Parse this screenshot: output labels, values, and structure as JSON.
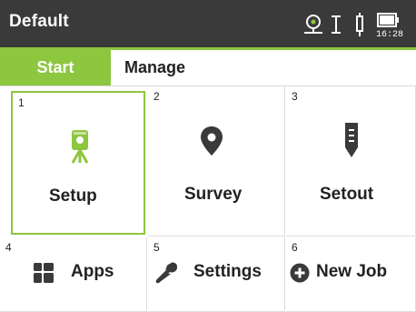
{
  "header": {
    "title": "Default",
    "time": "16:28",
    "status_icons": [
      "target-icon",
      "cursor-i-icon",
      "pole-icon",
      "battery-icon"
    ]
  },
  "colors": {
    "accent": "#8dc63f",
    "titlebar_bg": "#3a3a3a",
    "text": "#222222"
  },
  "tabs": [
    {
      "label": "Start",
      "active": true
    },
    {
      "label": "Manage",
      "active": false
    }
  ],
  "tiles": [
    {
      "number": "1",
      "label": "Setup",
      "icon": "tripod-icon",
      "selected": true
    },
    {
      "number": "2",
      "label": "Survey",
      "icon": "map-pin-icon",
      "selected": false
    },
    {
      "number": "3",
      "label": "Setout",
      "icon": "stake-icon",
      "selected": false
    },
    {
      "number": "4",
      "label": "Apps",
      "icon": "apps-grid-icon",
      "selected": false
    },
    {
      "number": "5",
      "label": "Settings",
      "icon": "wrench-icon",
      "selected": false
    },
    {
      "number": "6",
      "label": "New Job",
      "icon": "plus-circle-icon",
      "selected": false
    }
  ]
}
